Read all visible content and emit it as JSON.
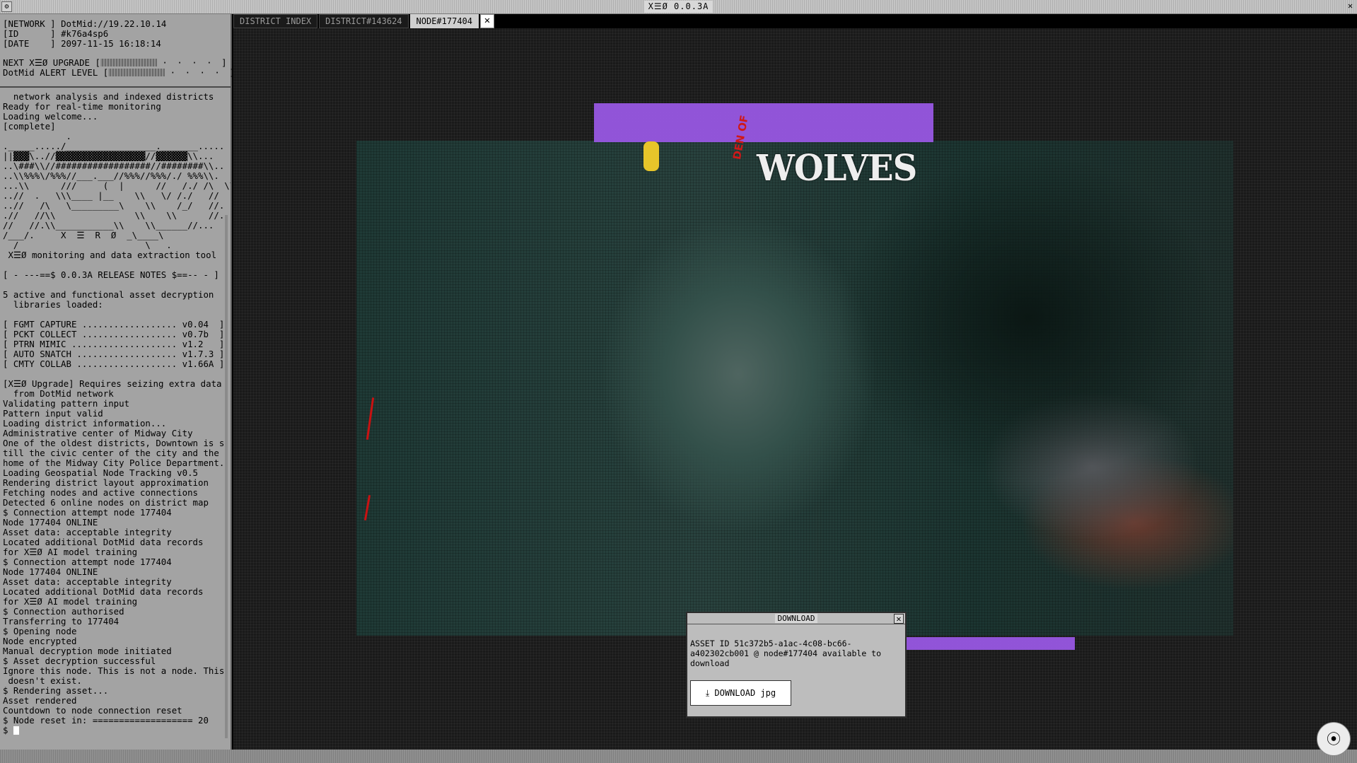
{
  "window": {
    "title": "X☰Ø 0.0.3A",
    "menu_icon": "menu-icon",
    "close_label": "✕"
  },
  "terminal": {
    "header": {
      "network_label": "[NETWORK ]",
      "network_value": "DotMid://19.22.10.14",
      "id_label": "[ID      ]",
      "id_value": "#k76a4sp6",
      "date_label": "[DATE    ]",
      "date_value": "2097-11-15 16:18:14",
      "upgrade_label": "NEXT X☰Ø UPGRADE [",
      "alert_label": "DotMid ALERT LEVEL [",
      "bar_dots": "· · · · ]"
    },
    "log": [
      "  network analysis and indexed districts",
      "Ready for real-time monitoring",
      "Loading welcome...",
      "[complete]",
      "            .",
      "._____...../_________________._______.....",
      "||▓▓▓\\..//▓▓▓▓▓▓▓▓▓▓▓▓▓▓▓▓▓//▓▓▓▓▓▓\\\\...",
      "..\\###\\\\//##################//########\\\\..",
      "..\\\\%%%\\/%%%//___.___//%%%//%%%/./ %%%\\\\.",
      "...\\\\      ///     (  |      //   /./ /\\  \\\\",
      "..//  .   \\\\\\____ |__    \\\\   \\/ /./   //",
      "..//   /\\   \\_________\\    \\\\    /_/   //.",
      ".//   //\\\\               \\\\    \\\\      //..",
      "//   //.\\\\___________\\\\    \\\\______//...",
      "/___/.     X  ☰  R  Ø  _\\____\\",
      "  /                        \\   .",
      " X☰Ø monitoring and data extraction tool",
      "",
      "[ - ---==$ 0.0.3A RELEASE NOTES $==-- - ]",
      "",
      "5 active and functional asset decryption",
      "  libraries loaded:",
      "",
      "[ FGMT CAPTURE .................. v0.04  ]",
      "[ PCKT COLLECT .................. v0.7b  ]",
      "[ PTRN MIMIC .................... v1.2   ]",
      "[ AUTO SNATCH ................... v1.7.3 ]",
      "[ CMTY COLLAB ................... v1.66A ]",
      "",
      "[X☰Ø Upgrade] Requires seizing extra data",
      "  from DotMid network",
      "Validating pattern input",
      "Pattern input valid",
      "Loading district information...",
      "Administrative center of Midway City",
      "One of the oldest districts, Downtown is s",
      "till the civic center of the city and the",
      "home of the Midway City Police Department.",
      "Loading Geospatial Node Tracking v0.5",
      "Rendering district layout approximation",
      "Fetching nodes and active connections",
      "Detected 6 online nodes on district map",
      "$ Connection attempt node 177404",
      "Node 177404 ONLINE",
      "Asset data: acceptable integrity",
      "Located additional DotMid data records",
      "for X☰Ø AI model training",
      "$ Connection attempt node 177404",
      "Node 177404 ONLINE",
      "Asset data: acceptable integrity",
      "Located additional DotMid data records",
      "for X☰Ø AI model training",
      "$ Connection authorised",
      "Transferring to 177404",
      "$ Opening node",
      "Node encrypted",
      "Manual decryption mode initiated",
      "$ Asset decryption successful",
      "Ignore this node. This is not a node. This",
      " doesn't exist.",
      "$ Rendering asset...",
      "Asset rendered",
      "Countdown to node connection reset",
      "$ Node reset in: =================== 20"
    ],
    "prompt": "$ "
  },
  "tabs": [
    {
      "label": "DISTRICT INDEX",
      "active": false
    },
    {
      "label": "DISTRICT#143624",
      "active": false
    },
    {
      "label": "NODE#177404",
      "active": true
    }
  ],
  "tab_close_label": "✕",
  "asset": {
    "title_pre": "DEN OF",
    "title": "WOLVES",
    "accent_color": "#9b59e8",
    "asset_id": "51c372b5-a1ac-4c08-bc66-a402302cb001"
  },
  "dialog": {
    "title": "DOWNLOAD",
    "close_label": "✕",
    "message": "ASSET ID 51c372b5-a1ac-4c08-bc66-\na402302cb001 @ node#177404 available to\ndownload",
    "button_icon": "download-icon",
    "button_label": "⤓  DOWNLOAD jpg"
  },
  "fab": {
    "icon": "link-icon",
    "label": "⦿"
  }
}
